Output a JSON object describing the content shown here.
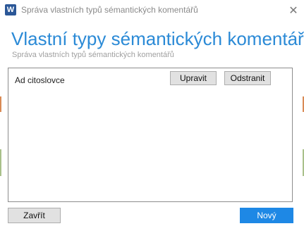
{
  "window": {
    "title": "Správa vlastních typů sémantických komentářů",
    "app_icon_letter": "W",
    "close_glyph": "✕"
  },
  "header": {
    "title": "Vlastní typy sémantických komentářů",
    "subtitle": "Správa vlastních typů sémantických komentářů"
  },
  "list": {
    "items": [
      {
        "label": "Ad citoslovce",
        "edit_label": "Upravit",
        "remove_label": "Odstranit"
      }
    ]
  },
  "footer": {
    "close_label": "Zavřít",
    "new_label": "Nový"
  },
  "colors": {
    "accent": "#2b8ad6",
    "primary_button": "#1e88e5"
  }
}
